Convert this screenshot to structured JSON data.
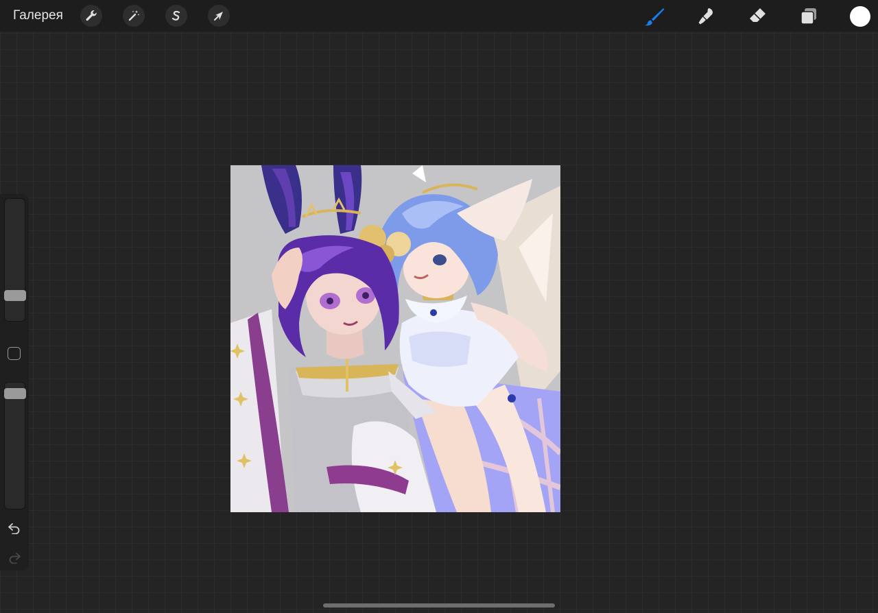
{
  "topbar": {
    "gallery_label": "Галерея",
    "left_tools": [
      {
        "icon": "wrench-icon"
      },
      {
        "icon": "magic-wand-icon"
      },
      {
        "icon": "selection-icon"
      },
      {
        "icon": "transform-arrow-icon"
      }
    ],
    "right_tools": [
      {
        "icon": "brush-icon",
        "active": true
      },
      {
        "icon": "smudge-icon"
      },
      {
        "icon": "eraser-icon"
      },
      {
        "icon": "layers-icon"
      }
    ],
    "current_color": "#ffffff"
  },
  "colors": {
    "accent": "#1a7cf0",
    "icon": "#e0e0e0",
    "workspace": "#242424",
    "toolbar": "#1d1d1d"
  },
  "sidebar": {
    "brush_size_level": 0.18,
    "opacity_level": 0.95,
    "undo_icon": "undo-icon",
    "redo_icon": "redo-icon"
  },
  "canvas": {
    "content": "artwork"
  }
}
